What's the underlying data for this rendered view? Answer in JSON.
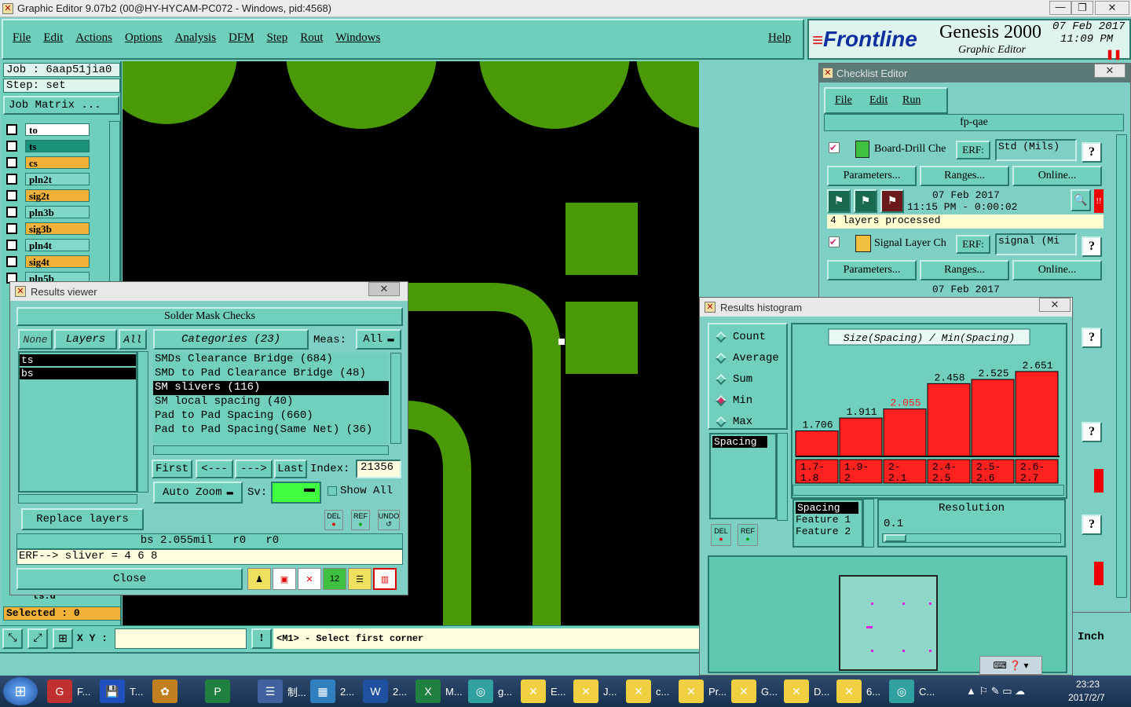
{
  "window_title": "Graphic Editor 9.07b2 (00@HY-HYCAM-PC072 - Windows, pid:4568)",
  "menu": [
    "File",
    "Edit",
    "Actions",
    "Options",
    "Analysis",
    "DFM",
    "Step",
    "Rout",
    "Windows"
  ],
  "help_label": "Help",
  "brand": {
    "logo": "Frontline",
    "product": "Genesis 2000",
    "subtitle": "Graphic Editor",
    "date": "07 Feb 2017",
    "time": "11:09 PM"
  },
  "job": {
    "job_label": "Job : 6aap51jia0",
    "step_label": "Step: set",
    "matrix_btn": "Job Matrix ..."
  },
  "layers": [
    {
      "name": "to",
      "color": "#ffffff"
    },
    {
      "name": "ts",
      "color": "#1a8f7a"
    },
    {
      "name": "cs",
      "color": "#f2b23a"
    },
    {
      "name": "pln2t",
      "color": "#7fd8c8"
    },
    {
      "name": "sig2t",
      "color": "#f2b23a"
    },
    {
      "name": "pln3b",
      "color": "#7fd8c8"
    },
    {
      "name": "sig3b",
      "color": "#f2b23a"
    },
    {
      "name": "pln4t",
      "color": "#7fd8c8"
    },
    {
      "name": "sig4t",
      "color": "#f2b23a"
    },
    {
      "name": "pln5b",
      "color": "#7fd8c8"
    }
  ],
  "layer_hidden_tail": "ts.d",
  "selected": "Selected : 0",
  "coord": {
    "xy_label": "X Y :",
    "xy_value": "",
    "prompt": "<M1> - Select first corner",
    "units": "Inch"
  },
  "results_viewer": {
    "title": "Results viewer",
    "header": "Solder Mask Checks",
    "none_btn": "None",
    "layers_btn": "Layers",
    "all_btn": "All",
    "categories_btn": "Categories (23)",
    "meas_label": "Meas:",
    "meas_value": "All",
    "layer_list": [
      "ts",
      "bs"
    ],
    "categories": [
      "SMDs Clearance Bridge (684)",
      "SMD to Pad Clearance Bridge (48)",
      "SM slivers (116)",
      "SM local spacing (40)",
      "Pad to Pad Spacing (660)",
      "Pad to Pad Spacing(Same Net) (36)"
    ],
    "first_btn": "First",
    "prev_btn": "<---",
    "next_btn": "--->",
    "last_btn": "Last",
    "index_label": "Index:",
    "index_value": "21356",
    "autozoom_btn": "Auto Zoom",
    "sv_label": "Sv:",
    "show_all": "Show All",
    "replace_btn": "Replace layers",
    "del_btn": "DEL",
    "ref_btn": "REF",
    "undo_btn": "UNDO",
    "status": "bs 2.055mil   r0   r0",
    "erf": "ERF--> sliver = 4 6 8",
    "close_btn": "Close"
  },
  "checklist": {
    "title": "Checklist Editor",
    "menu": [
      "File",
      "Edit",
      "Run"
    ],
    "name": "fp-qae",
    "items": [
      {
        "name": "Board-Drill Che",
        "erf_btn": "ERF:",
        "erf_value": "Std (Mils)",
        "params": "Parameters...",
        "ranges": "Ranges...",
        "online": "Online...",
        "date": "07 Feb 2017",
        "time": "11:15 PM - 0:00:02",
        "status": "4 layers processed"
      },
      {
        "name": "Signal Layer Ch",
        "erf_btn": "ERF:",
        "erf_value": "signal (Mi",
        "params": "Parameters...",
        "ranges": "Ranges...",
        "online": "Online...",
        "date": "07 Feb 2017"
      }
    ],
    "help": "?"
  },
  "histogram": {
    "title": "Results histogram",
    "modes": [
      "Count",
      "Average",
      "Sum",
      "Min",
      "Max"
    ],
    "selected_mode": "Min",
    "list_item": "Spacing",
    "chart_title": "Size(Spacing) / Min(Spacing)",
    "spacing_items": [
      "Spacing",
      "Feature 1",
      "Feature 2"
    ],
    "resolution_label": "Resolution",
    "resolution_value": "0.1",
    "del_btn": "DEL",
    "ref_btn": "REF"
  },
  "chart_data": {
    "type": "bar",
    "title": "Size(Spacing) / Min(Spacing)",
    "categories": [
      "1.7- 1.8",
      "1.9- 2",
      "2- 2.1",
      "2.4- 2.5",
      "2.5- 2.6",
      "2.6- 2.7"
    ],
    "values": [
      1.706,
      1.911,
      2.055,
      2.458,
      2.525,
      2.651
    ],
    "value_labels": [
      "1.706",
      "1.911",
      "2.055",
      "2.458",
      "2.525",
      "2.651"
    ],
    "highlighted_index": 2,
    "bar_color": "#ff2020",
    "ylim": [
      1.3,
      2.75
    ]
  },
  "taskbar": {
    "items": [
      "F...",
      "T...",
      "",
      "",
      "制...",
      "2...",
      "2...",
      "M...",
      "g...",
      "E...",
      "J...",
      "c...",
      "Pr...",
      "G...",
      "D...",
      "6...",
      "C..."
    ],
    "clock_time": "23:23",
    "clock_date": "2017/2/7"
  }
}
